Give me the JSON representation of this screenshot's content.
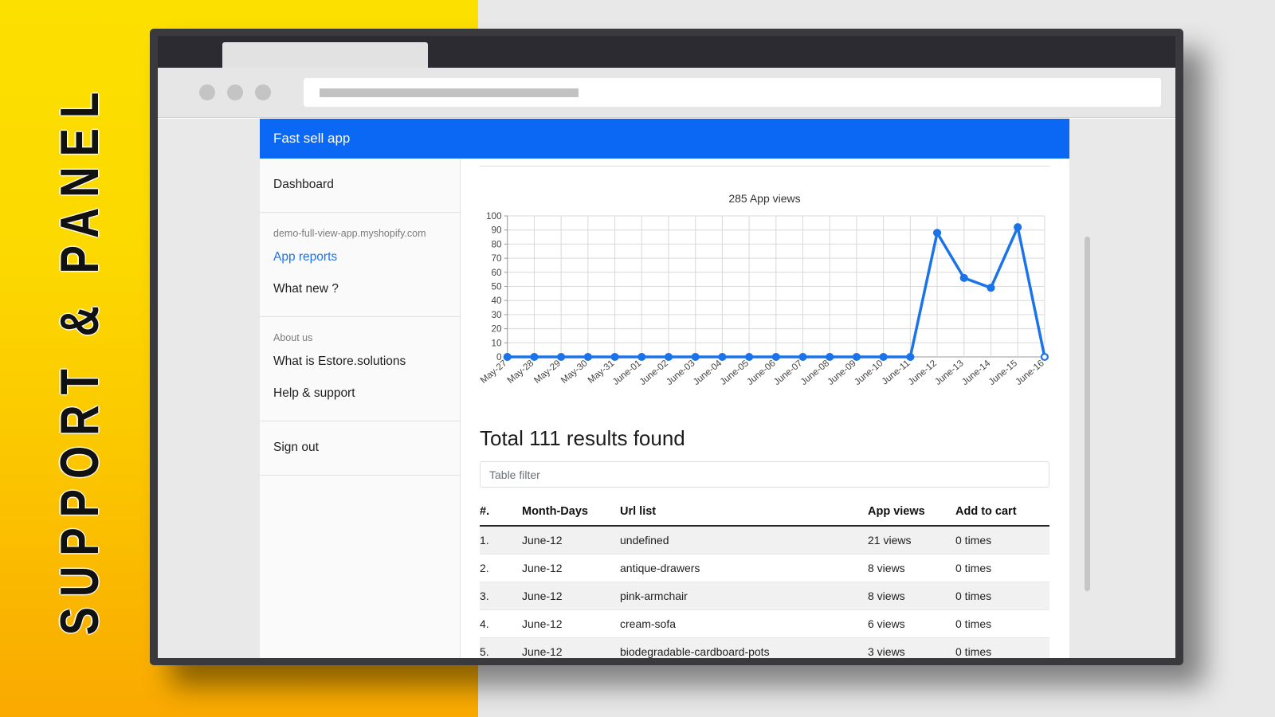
{
  "promo": {
    "text": "SUPPORT & PANEL",
    "bg_top": "#FCE000",
    "bg_bottom": "#FAA900"
  },
  "browser": {
    "frame_color": "#3A3A3E",
    "titlebar_color": "#2B2B31",
    "tab_label": "",
    "url_value": "",
    "url_placeholder": ""
  },
  "app": {
    "header": {
      "title": "Fast sell app",
      "accent_color": "#0A68F5"
    },
    "sidebar": {
      "groups": [
        {
          "items": [
            {
              "label": "Dashboard",
              "type": "item"
            }
          ]
        },
        {
          "items": [
            {
              "label": "demo-full-view-app.myshopify.com",
              "type": "caption"
            },
            {
              "label": "App reports",
              "type": "link"
            },
            {
              "label": "What new ?",
              "type": "item"
            }
          ]
        },
        {
          "items": [
            {
              "label": "About us",
              "type": "caption"
            },
            {
              "label": "What is Estore.solutions",
              "type": "item"
            },
            {
              "label": "Help & support",
              "type": "item"
            }
          ]
        },
        {
          "items": [
            {
              "label": "Sign out",
              "type": "item"
            }
          ]
        }
      ]
    },
    "main": {
      "results_heading": "Total 111 results found",
      "filter_placeholder": "Table filter",
      "filter_value": "",
      "table": {
        "headers": [
          "#.",
          "Month-Days",
          "Url list",
          "App views",
          "Add to cart"
        ],
        "rows": [
          [
            "1.",
            "June-12",
            "undefined",
            "21 views",
            "0 times"
          ],
          [
            "2.",
            "June-12",
            "antique-drawers",
            "8 views",
            "0 times"
          ],
          [
            "3.",
            "June-12",
            "pink-armchair",
            "8 views",
            "0 times"
          ],
          [
            "4.",
            "June-12",
            "cream-sofa",
            "6 views",
            "0 times"
          ],
          [
            "5.",
            "June-12",
            "biodegradable-cardboard-pots",
            "3 views",
            "0 times"
          ]
        ]
      }
    }
  },
  "chart_data": {
    "type": "line",
    "title": "285 App views",
    "xlabel": "",
    "ylabel": "",
    "ylim": [
      0,
      100
    ],
    "yticks": [
      0,
      10,
      20,
      30,
      40,
      50,
      60,
      70,
      80,
      90,
      100
    ],
    "grid": true,
    "legend": "none",
    "line_color": "#1a73e8",
    "categories": [
      "May-27",
      "May-28",
      "May-29",
      "May-30",
      "May-31",
      "June-01",
      "June-02",
      "June-03",
      "June-04",
      "June-05",
      "June-06",
      "June-07",
      "June-08",
      "June-09",
      "June-10",
      "June-11",
      "June-12",
      "June-13",
      "June-14",
      "June-15",
      "June-16"
    ],
    "values": [
      0,
      0,
      0,
      0,
      0,
      0,
      0,
      0,
      0,
      0,
      0,
      0,
      0,
      0,
      0,
      0,
      88,
      56,
      49,
      92,
      0
    ],
    "series": [
      {
        "name": "App views",
        "values": [
          0,
          0,
          0,
          0,
          0,
          0,
          0,
          0,
          0,
          0,
          0,
          0,
          0,
          0,
          0,
          0,
          88,
          56,
          49,
          92,
          0
        ]
      }
    ]
  }
}
